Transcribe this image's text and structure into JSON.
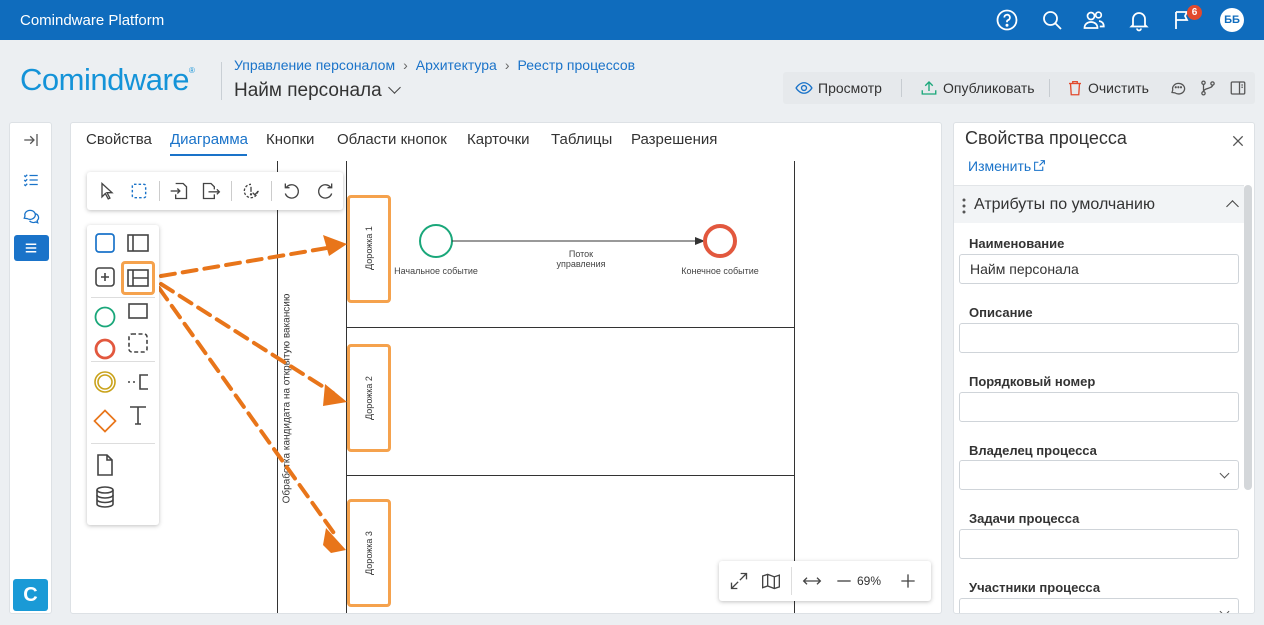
{
  "topbar": {
    "brand": "Comindware Platform",
    "notification_count": "6",
    "avatar_initials": "ББ"
  },
  "header": {
    "logo_text": "Comindware",
    "logo_mark": "®",
    "breadcrumbs": [
      "Управление персоналом",
      "Архитектура",
      "Реестр процессов"
    ],
    "title": "Найм персонала"
  },
  "actions": {
    "preview": "Просмотр",
    "publish": "Опубликовать",
    "clear": "Очистить"
  },
  "rail": {
    "logo_letter": "C"
  },
  "tabs": [
    {
      "label": "Свойства",
      "active": false
    },
    {
      "label": "Диаграмма",
      "active": true
    },
    {
      "label": "Кнопки",
      "active": false
    },
    {
      "label": "Области кнопок",
      "active": false
    },
    {
      "label": "Карточки",
      "active": false
    },
    {
      "label": "Таблицы",
      "active": false
    },
    {
      "label": "Разрешения",
      "active": false
    }
  ],
  "diagram": {
    "pool_label": "Обработка кандидата на открытую вакансию",
    "lanes": [
      "Дорожка 1",
      "Дорожка 2",
      "Дорожка 3"
    ],
    "start_event": "Начальное событие",
    "end_event": "Конечное событие",
    "flow_label_line1": "Поток",
    "flow_label_line2": "управления",
    "zoom": "69%"
  },
  "colors": {
    "accent": "#1a73c9",
    "topbar": "#0f6cbd",
    "highlight": "#f5a24d",
    "arrow": "#e8751a",
    "start_event": "#1aa77a",
    "end_event": "#e2583e"
  },
  "right_panel": {
    "title": "Свойства процесса",
    "edit_link": "Изменить",
    "section_title": "Атрибуты по умолчанию",
    "fields": [
      {
        "label": "Наименование",
        "value": "Найм персонала",
        "dropdown": false
      },
      {
        "label": "Описание",
        "value": "",
        "dropdown": false
      },
      {
        "label": "Порядковый номер",
        "value": "",
        "dropdown": false
      },
      {
        "label": "Владелец процесса",
        "value": "",
        "dropdown": true
      },
      {
        "label": "Задачи процесса",
        "value": "",
        "dropdown": false
      },
      {
        "label": "Участники процесса",
        "value": "",
        "dropdown": true
      }
    ]
  }
}
